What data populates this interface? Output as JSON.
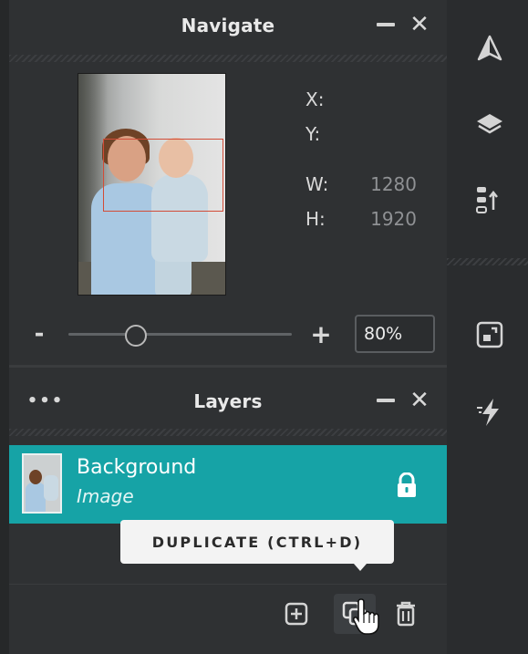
{
  "navigate": {
    "title": "Navigate",
    "x_label": "X:",
    "y_label": "Y:",
    "w_label": "W:",
    "w_value": "1280",
    "h_label": "H:",
    "h_value": "1920"
  },
  "zoom": {
    "minus": "-",
    "plus": "+",
    "value": "80%",
    "slider_fraction": 0.3
  },
  "layers": {
    "more": "•••",
    "title": "Layers",
    "items": [
      {
        "name": "Background",
        "type": "Image",
        "locked": true
      }
    ]
  },
  "tooltip": {
    "text": "DUPLICATE (CTRL+D)"
  },
  "bottom_actions": [
    {
      "icon": "add-layer-icon"
    },
    {
      "icon": "duplicate-icon"
    },
    {
      "icon": "trash-icon"
    }
  ],
  "toolbar": [
    {
      "icon": "navigate-icon"
    },
    {
      "icon": "layers-icon"
    },
    {
      "icon": "history-icon"
    },
    {
      "icon": "crop-resize-icon"
    },
    {
      "icon": "quick-actions-icon"
    }
  ],
  "colors": {
    "accent": "#16a3a6",
    "selection": "#d24c37"
  }
}
